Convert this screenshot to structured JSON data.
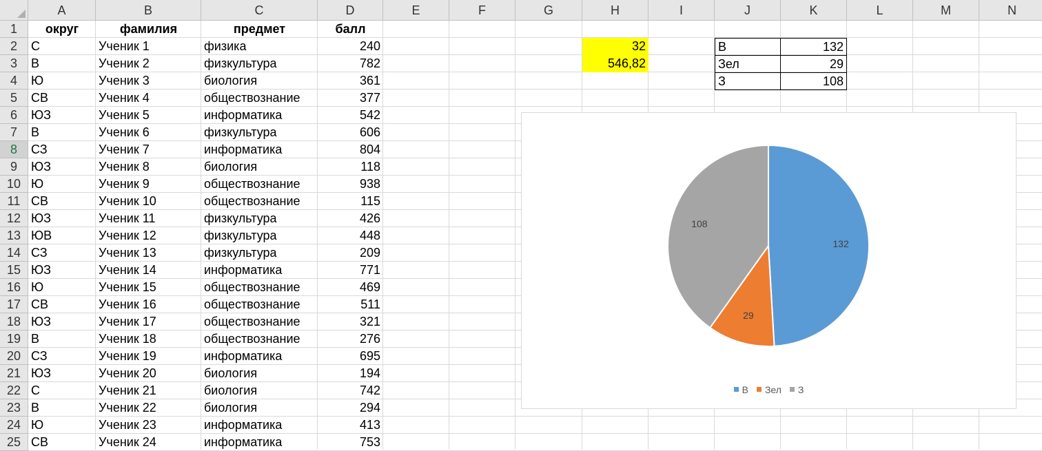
{
  "columns": [
    "A",
    "B",
    "C",
    "D",
    "E",
    "F",
    "G",
    "H",
    "I",
    "J",
    "K",
    "L",
    "M",
    "N"
  ],
  "header": {
    "okrug": "округ",
    "familiya": "фамилия",
    "predmet": "предмет",
    "ball": "балл"
  },
  "rows": [
    {
      "n": "1"
    },
    {
      "n": "2",
      "a": "С",
      "b": "Ученик 1",
      "c": "физика",
      "d": "240"
    },
    {
      "n": "3",
      "a": "В",
      "b": "Ученик 2",
      "c": "физкультура",
      "d": "782"
    },
    {
      "n": "4",
      "a": "Ю",
      "b": "Ученик 3",
      "c": "биология",
      "d": "361"
    },
    {
      "n": "5",
      "a": "СВ",
      "b": "Ученик 4",
      "c": "обществознание",
      "d": "377"
    },
    {
      "n": "6",
      "a": "ЮЗ",
      "b": "Ученик 5",
      "c": "информатика",
      "d": "542"
    },
    {
      "n": "7",
      "a": "В",
      "b": "Ученик 6",
      "c": "физкультура",
      "d": "606"
    },
    {
      "n": "8",
      "a": "СЗ",
      "b": "Ученик 7",
      "c": "информатика",
      "d": "804"
    },
    {
      "n": "9",
      "a": "ЮЗ",
      "b": "Ученик 8",
      "c": "биология",
      "d": "118"
    },
    {
      "n": "10",
      "a": "Ю",
      "b": "Ученик 9",
      "c": "обществознание",
      "d": "938"
    },
    {
      "n": "11",
      "a": "СВ",
      "b": "Ученик 10",
      "c": "обществознание",
      "d": "115"
    },
    {
      "n": "12",
      "a": "ЮЗ",
      "b": "Ученик 11",
      "c": "физкультура",
      "d": "426"
    },
    {
      "n": "13",
      "a": "ЮВ",
      "b": "Ученик 12",
      "c": "физкультура",
      "d": "448"
    },
    {
      "n": "14",
      "a": "СЗ",
      "b": "Ученик 13",
      "c": "физкультура",
      "d": "209"
    },
    {
      "n": "15",
      "a": "ЮЗ",
      "b": "Ученик 14",
      "c": "информатика",
      "d": "771"
    },
    {
      "n": "16",
      "a": "Ю",
      "b": "Ученик 15",
      "c": "обществознание",
      "d": "469"
    },
    {
      "n": "17",
      "a": "СВ",
      "b": "Ученик 16",
      "c": "обществознание",
      "d": "511"
    },
    {
      "n": "18",
      "a": "ЮЗ",
      "b": "Ученик 17",
      "c": "обществознание",
      "d": "321"
    },
    {
      "n": "19",
      "a": "В",
      "b": "Ученик 18",
      "c": "обществознание",
      "d": "276"
    },
    {
      "n": "20",
      "a": "СЗ",
      "b": "Ученик 19",
      "c": "информатика",
      "d": "695"
    },
    {
      "n": "21",
      "a": "ЮЗ",
      "b": "Ученик 20",
      "c": "биология",
      "d": "194"
    },
    {
      "n": "22",
      "a": "С",
      "b": "Ученик 21",
      "c": "биология",
      "d": "742"
    },
    {
      "n": "23",
      "a": "В",
      "b": "Ученик 22",
      "c": "биология",
      "d": "294"
    },
    {
      "n": "24",
      "a": "Ю",
      "b": "Ученик 23",
      "c": "информатика",
      "d": "413"
    },
    {
      "n": "25",
      "a": "СВ",
      "b": "Ученик 24",
      "c": "информатика",
      "d": "753"
    }
  ],
  "selected_row": "8",
  "h_values": {
    "h2": "32",
    "h3": "546,82"
  },
  "summary_table": [
    {
      "label": "В",
      "value": "132"
    },
    {
      "label": "Зел",
      "value": "29"
    },
    {
      "label": "З",
      "value": "108"
    }
  ],
  "colors": {
    "highlight": "#ffff00",
    "blue": "#5b9bd5",
    "orange": "#ed7d31",
    "gray": "#a5a5a5",
    "selected_row": "#217346"
  },
  "chart_data": {
    "type": "pie",
    "categories": [
      "В",
      "Зел",
      "З"
    ],
    "values": [
      132,
      29,
      108
    ],
    "colors": [
      "#5b9bd5",
      "#ed7d31",
      "#a5a5a5"
    ],
    "data_labels": [
      "132",
      "29",
      "108"
    ],
    "legend": "bottom"
  }
}
